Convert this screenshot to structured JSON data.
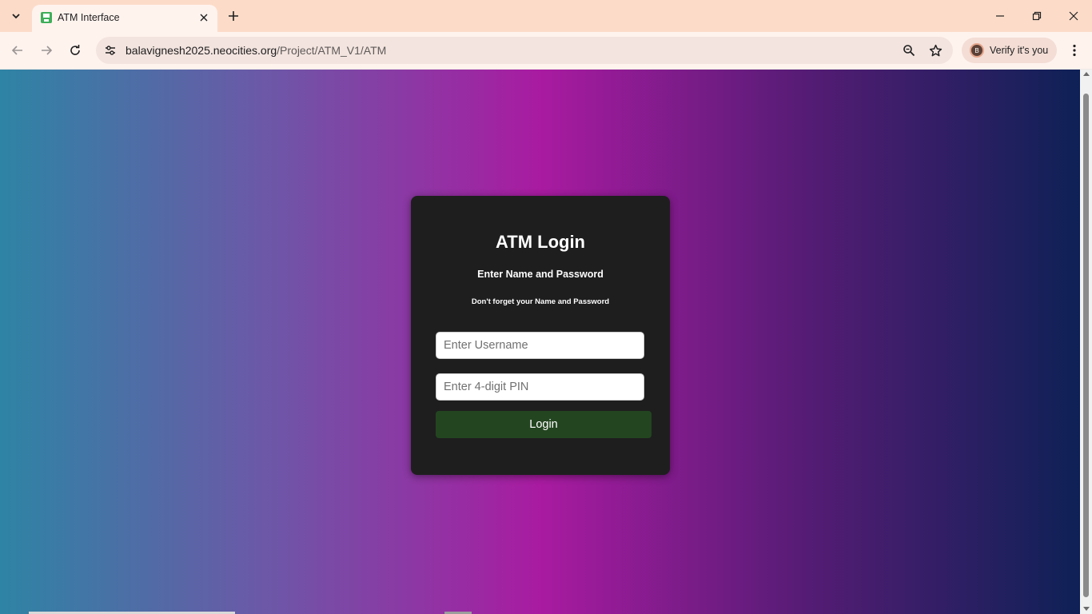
{
  "browser": {
    "tab": {
      "title": "ATM Interface"
    },
    "address": {
      "domain": "balavignesh2025.neocities.org",
      "path": "/Project/ATM_V1/ATM"
    },
    "profile": {
      "verify_label": "Verify it's you",
      "avatar_letter": "B"
    }
  },
  "page": {
    "title": "ATM Login",
    "subtitle": "Enter Name and Password",
    "note": "Don't forget your Name and Password",
    "username_placeholder": "Enter Username",
    "pin_placeholder": "Enter 4-digit PIN",
    "login_label": "Login"
  },
  "colors": {
    "card_bg": "#1e1e1e",
    "button_bg": "#234620",
    "gradient": [
      "#2e84a5",
      "#6d57a7",
      "#a91ba1",
      "#541c74",
      "#0e2156"
    ]
  }
}
